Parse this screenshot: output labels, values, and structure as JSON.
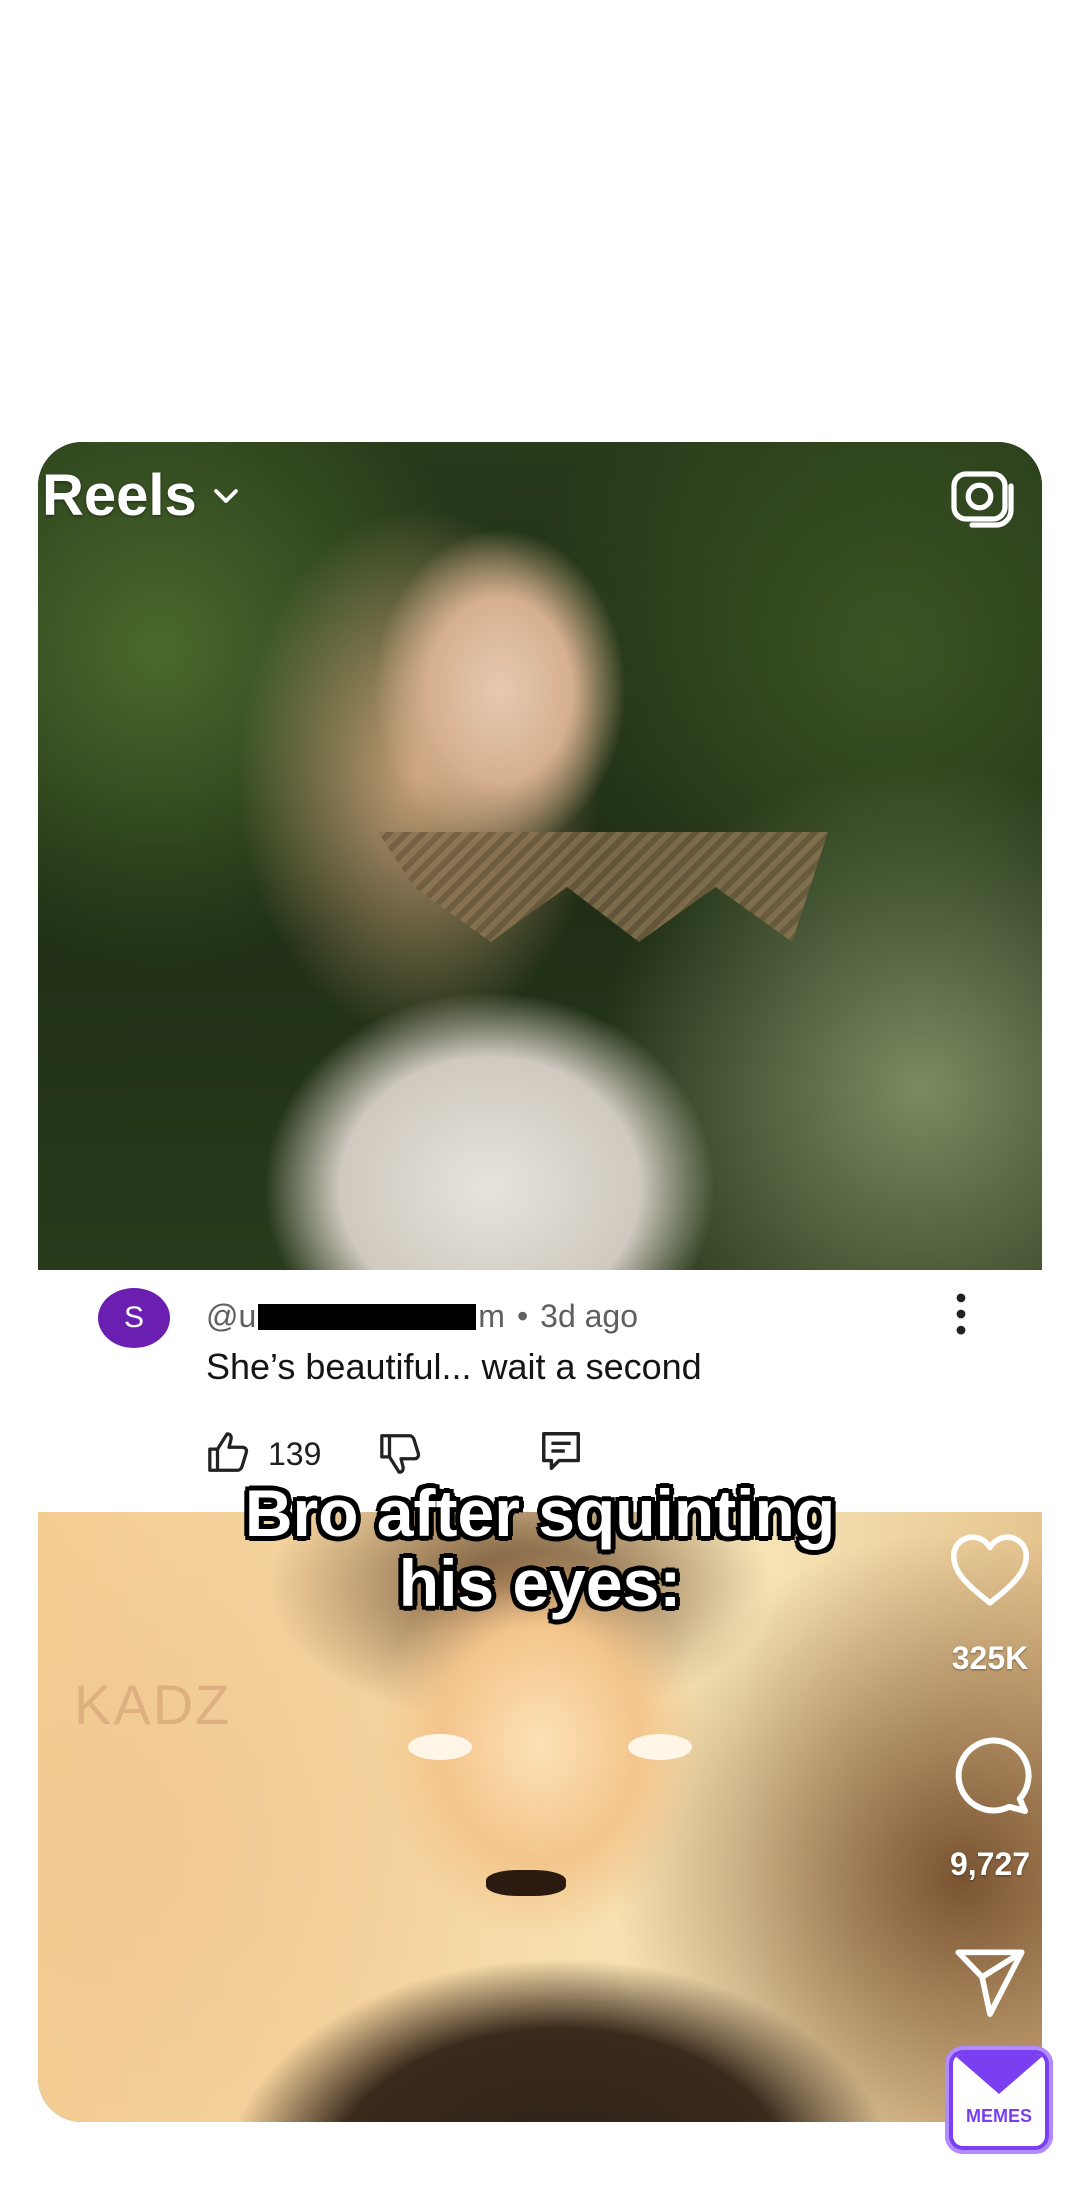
{
  "header": {
    "title": "Reels"
  },
  "comment": {
    "avatar_letter": "S",
    "handle_start": "@u",
    "handle_end": "m",
    "time_ago": "3d ago",
    "text": "She’s beautiful... wait a second",
    "like_count": "139"
  },
  "video": {
    "caption_line1": "Bro after squinting",
    "caption_line2": "his eyes:",
    "watermark": "KADZ"
  },
  "actions": {
    "likes": "325K",
    "comments": "9,727"
  },
  "badge": {
    "label": "MEMES"
  },
  "icons": [
    "chevron-down-icon",
    "camera-icon",
    "more-vert-icon",
    "thumbs-up-icon",
    "thumbs-down-icon",
    "reply-icon",
    "heart-icon",
    "comment-icon",
    "send-icon",
    "memes-logo-icon"
  ]
}
